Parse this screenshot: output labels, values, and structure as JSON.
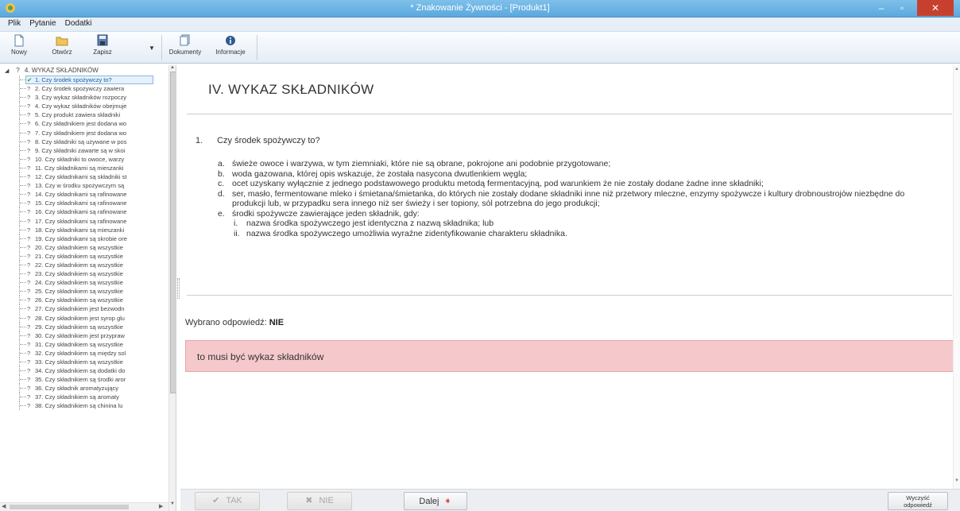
{
  "window": {
    "title": "* Znakowanie Żywności - [Produkt1]"
  },
  "menu": [
    "Plik",
    "Pytanie",
    "Dodatki"
  ],
  "toolbar": {
    "nowy": "Nowy",
    "otworz": "Otwórz",
    "zapisz": "Zapisz",
    "dokumenty": "Dokumenty",
    "informacje": "Informacje"
  },
  "tree": {
    "root": "4. WYKAZ SKŁADNIKÓW",
    "items": [
      {
        "mark": "✔",
        "label": "1. Czy środek spożywczy to?",
        "selected": true
      },
      {
        "mark": "?",
        "label": "2. Czy środek spożywczy zawiera"
      },
      {
        "mark": "?",
        "label": "3. Czy wykaz składników rozpoczy"
      },
      {
        "mark": "?",
        "label": "4. Czy wykaz składników obejmuje"
      },
      {
        "mark": "?",
        "label": "5. Czy produkt zawiera składniki"
      },
      {
        "mark": "?",
        "label": "6. Czy składnikiem jest dodana wo"
      },
      {
        "mark": "?",
        "label": "7. Czy składnikiem jest dodana wo"
      },
      {
        "mark": "?",
        "label": "8. Czy składniki są używane w pos"
      },
      {
        "mark": "?",
        "label": "9. Czy składniki zawarte są w skoi"
      },
      {
        "mark": "?",
        "label": "10. Czy składniki to owoce, warzy"
      },
      {
        "mark": "?",
        "label": "11. Czy składnikami są mieszanki"
      },
      {
        "mark": "?",
        "label": "12. Czy składnikami są składniki st"
      },
      {
        "mark": "?",
        "label": "13. Czy w środku spożywczym są"
      },
      {
        "mark": "?",
        "label": "14. Czy składnikami są rafinowane"
      },
      {
        "mark": "?",
        "label": "15. Czy składnikami są rafinowane"
      },
      {
        "mark": "?",
        "label": "16. Czy składnikami są rafinowane"
      },
      {
        "mark": "?",
        "label": "17. Czy składnikami są rafinowane"
      },
      {
        "mark": "?",
        "label": "18. Czy składnikami są mieszanki"
      },
      {
        "mark": "?",
        "label": "19. Czy składnikami są skrobie ore"
      },
      {
        "mark": "?",
        "label": "20. Czy składnikiem są wszystkie"
      },
      {
        "mark": "?",
        "label": "21. Czy składnikiem są wszystkie"
      },
      {
        "mark": "?",
        "label": "22. Czy składnikiem są wszystkie"
      },
      {
        "mark": "?",
        "label": "23. Czy składnikiem są wszystkie"
      },
      {
        "mark": "?",
        "label": "24. Czy składnikiem są wszystkie"
      },
      {
        "mark": "?",
        "label": "25. Czy składnikiem są wszystkie"
      },
      {
        "mark": "?",
        "label": "26. Czy składnikiem są wszystkie"
      },
      {
        "mark": "?",
        "label": "27. Czy składnikiem jest bezwodn"
      },
      {
        "mark": "?",
        "label": "28. Czy składnikiem jest syrop glu"
      },
      {
        "mark": "?",
        "label": "29. Czy składnikiem są wszystkie"
      },
      {
        "mark": "?",
        "label": "30. Czy składnikiem jest przypraw"
      },
      {
        "mark": "?",
        "label": "31. Czy składnikiem są wszystkie"
      },
      {
        "mark": "?",
        "label": "32. Czy składnikiem są między sol"
      },
      {
        "mark": "?",
        "label": "33. Czy składnikiem są wszystkie"
      },
      {
        "mark": "?",
        "label": "34. Czy składnikiem są dodatki do"
      },
      {
        "mark": "?",
        "label": "35. Czy składnikiem są środki aror"
      },
      {
        "mark": "?",
        "label": "36. Czy składnik aromatyzujący"
      },
      {
        "mark": "?",
        "label": "37. Czy składnikiem są aromaty"
      },
      {
        "mark": "?",
        "label": "38. Czy składnikiem są chinina lu"
      }
    ]
  },
  "main": {
    "section_title": "IV. WYKAZ SKŁADNIKÓW",
    "question_number": "1.",
    "question_text": "Czy środek spożywczy to?",
    "options": [
      {
        "letter": "a.",
        "text": "świeże owoce i warzywa, w tym ziemniaki, które nie są obrane, pokrojone ani podobnie przygotowane;"
      },
      {
        "letter": "b.",
        "text": "woda gazowana, której opis wskazuje, że została nasycona dwutlenkiem węgla;"
      },
      {
        "letter": "c.",
        "text": "ocet uzyskany wyłącznie z jednego podstawowego produktu metodą fermentacyjną, pod warunkiem że nie zostały dodane żadne inne składniki;"
      },
      {
        "letter": "d.",
        "text": "ser, masło, fermentowane mleko i śmietana/śmietanka, do których nie zostały dodane składniki inne niż przetwory mleczne, enzymy spożywcze i kultury drobnoustrojów niezbędne do produkcji lub, w przypadku sera innego niż ser świeży i ser topiony, sól potrzebna do jego produkcji;"
      },
      {
        "letter": "e.",
        "text": "środki spożywcze zawierające jeden składnik, gdy:"
      }
    ],
    "suboptions": [
      {
        "letter": "i.",
        "text": "nazwa środka spożywczego jest identyczna z nazwą składnika; lub"
      },
      {
        "letter": "ii.",
        "text": "nazwa środka spożywczego umożliwia wyraźne zidentyfikowanie charakteru składnika."
      }
    ],
    "answer_label": "Wybrano odpowiedź:",
    "answer_value": "NIE",
    "feedback": "to musi być wykaz składników"
  },
  "buttons": {
    "tak": "TAK",
    "nie": "NIE",
    "dalej": "Dalej",
    "clear_line1": "Wyczyść",
    "clear_line2": "odpowiedź"
  }
}
